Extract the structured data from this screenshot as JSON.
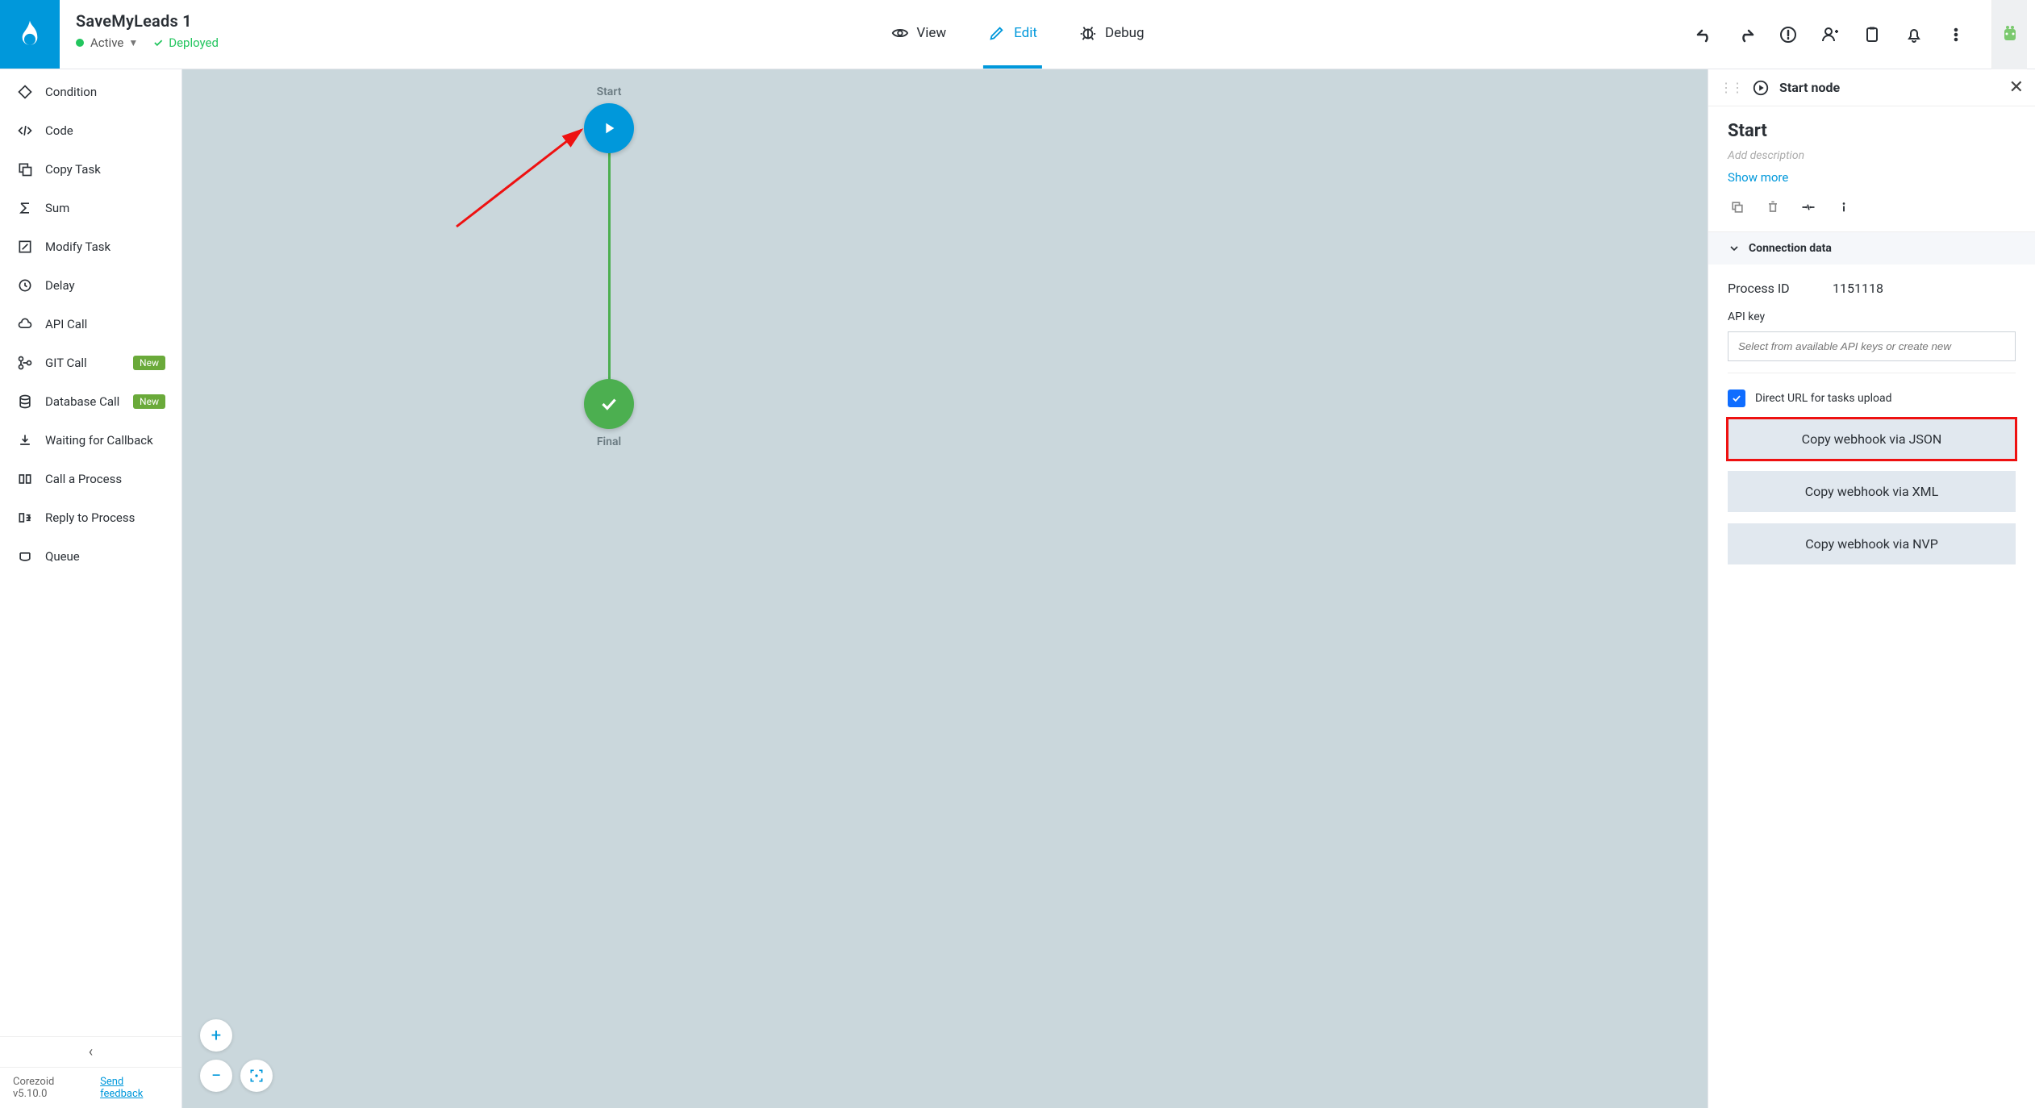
{
  "header": {
    "title": "SaveMyLeads 1",
    "statusActive": "Active",
    "statusDeployed": "Deployed",
    "tabs": {
      "view": "View",
      "edit": "Edit",
      "debug": "Debug"
    }
  },
  "sidebar": {
    "items": [
      {
        "label": "Condition",
        "icon": "diamond"
      },
      {
        "label": "Code",
        "icon": "code"
      },
      {
        "label": "Copy Task",
        "icon": "copytask"
      },
      {
        "label": "Sum",
        "icon": "sigma"
      },
      {
        "label": "Modify Task",
        "icon": "modify"
      },
      {
        "label": "Delay",
        "icon": "clock"
      },
      {
        "label": "API Call",
        "icon": "cloud"
      },
      {
        "label": "GIT Call",
        "icon": "git",
        "badge": "New"
      },
      {
        "label": "Database Call",
        "icon": "db",
        "badge": "New"
      },
      {
        "label": "Waiting for Callback",
        "icon": "waitcb"
      },
      {
        "label": "Call a Process",
        "icon": "callproc"
      },
      {
        "label": "Reply to Process",
        "icon": "reply"
      },
      {
        "label": "Queue",
        "icon": "queue"
      }
    ],
    "footer": {
      "version": "Corezoid v5.10.0",
      "feedback": "Send feedback"
    }
  },
  "canvas": {
    "startLabel": "Start",
    "finalLabel": "Final"
  },
  "panel": {
    "headTitle": "Start node",
    "title": "Start",
    "descPlaceholder": "Add description",
    "showMore": "Show more",
    "sectionTitle": "Connection data",
    "processIdLabel": "Process ID",
    "processIdValue": "1151118",
    "apiKeyLabel": "API key",
    "apiKeyPlaceholder": "Select from available API keys or create new",
    "directUrlLabel": "Direct URL for tasks upload",
    "whJson": "Copy webhook via JSON",
    "whXml": "Copy webhook via XML",
    "whNvp": "Copy webhook via NVP"
  }
}
